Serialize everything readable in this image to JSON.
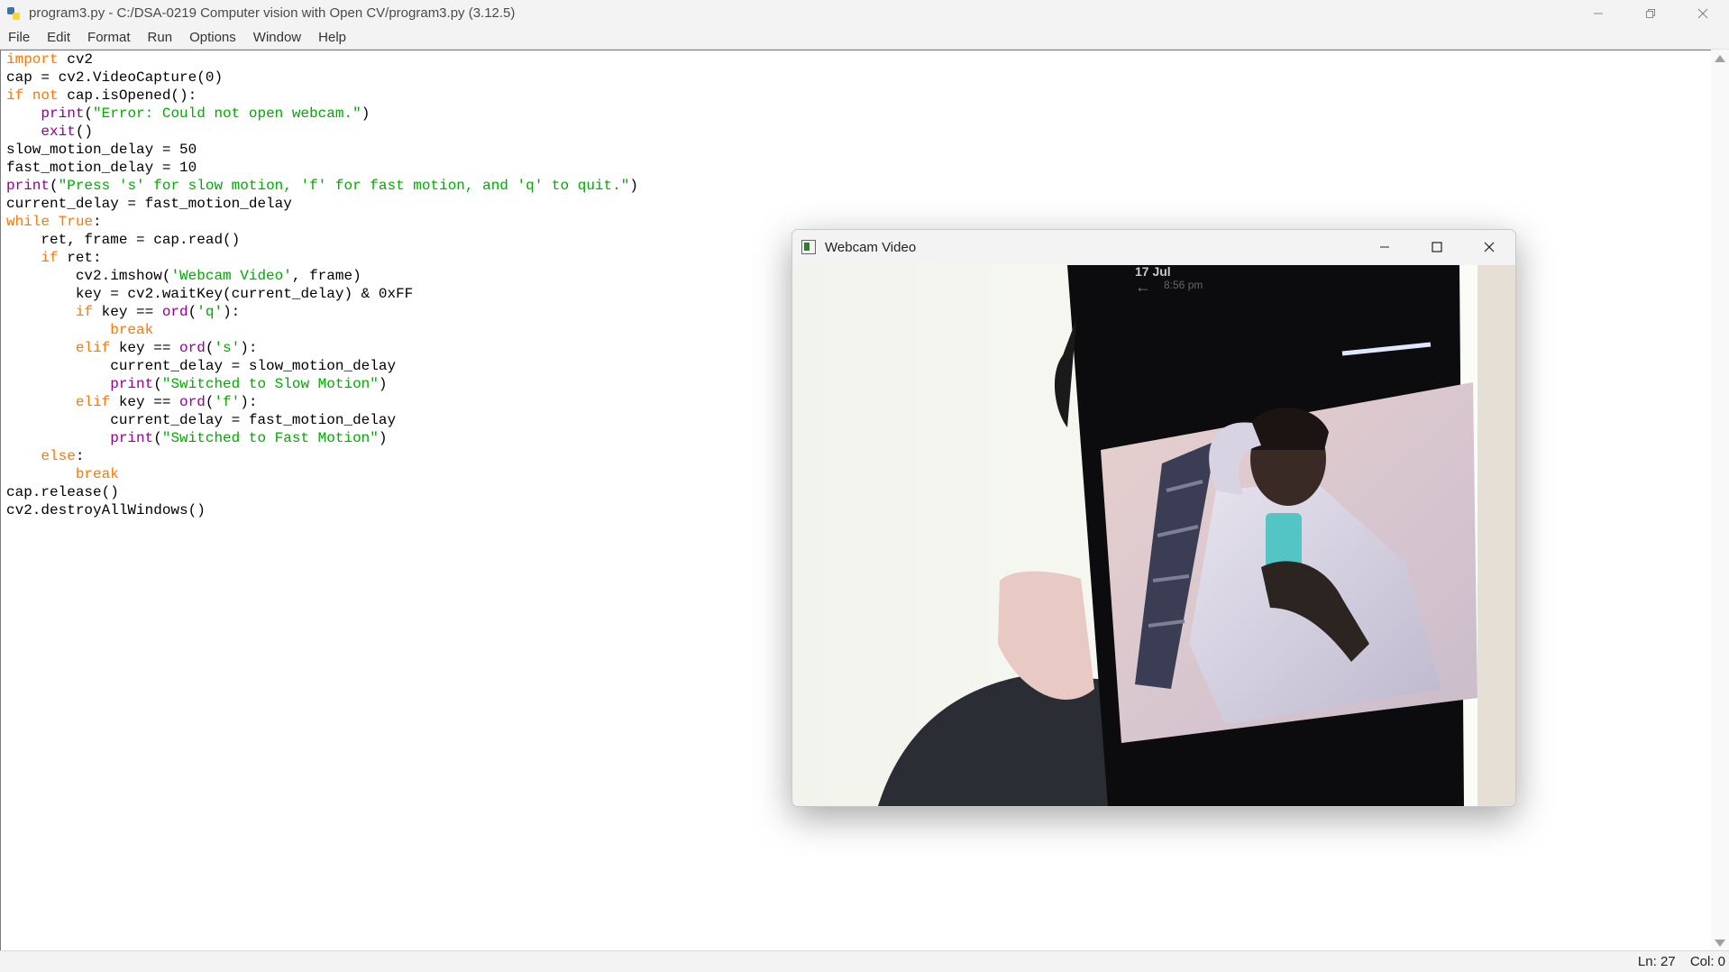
{
  "window": {
    "title": "program3.py - C:/DSA-0219 Computer vision with Open CV/program3.py (3.12.5)",
    "minimize_icon": "minimize-icon",
    "restore_icon": "restore-icon",
    "close_icon": "close-icon"
  },
  "menu": [
    "File",
    "Edit",
    "Format",
    "Run",
    "Options",
    "Window",
    "Help"
  ],
  "code_lines": [
    [
      [
        "kw",
        "import"
      ],
      [
        "t",
        " cv2"
      ]
    ],
    [
      [
        "t",
        "cap = cv2.VideoCapture(0)"
      ]
    ],
    [
      [
        "kw",
        "if not"
      ],
      [
        "t",
        " cap.isOpened():"
      ]
    ],
    [
      [
        "t",
        "    "
      ],
      [
        "bi",
        "print"
      ],
      [
        "t",
        "("
      ],
      [
        "str",
        "\"Error: Could not open webcam.\""
      ],
      [
        "t",
        ")"
      ]
    ],
    [
      [
        "t",
        "    "
      ],
      [
        "bi",
        "exit"
      ],
      [
        "t",
        "()"
      ]
    ],
    [
      [
        "t",
        "slow_motion_delay = 50"
      ]
    ],
    [
      [
        "t",
        "fast_motion_delay = 10"
      ]
    ],
    [
      [
        "bi",
        "print"
      ],
      [
        "t",
        "("
      ],
      [
        "str",
        "\"Press 's' for slow motion, 'f' for fast motion, and 'q' to quit.\""
      ],
      [
        "t",
        ")"
      ]
    ],
    [
      [
        "t",
        "current_delay = fast_motion_delay"
      ]
    ],
    [
      [
        "kw",
        "while"
      ],
      [
        "t",
        " "
      ],
      [
        "kw",
        "True"
      ],
      [
        "t",
        ":"
      ]
    ],
    [
      [
        "t",
        "    ret, frame = cap.read()"
      ]
    ],
    [
      [
        "t",
        "    "
      ],
      [
        "kw",
        "if"
      ],
      [
        "t",
        " ret:"
      ]
    ],
    [
      [
        "t",
        "        cv2.imshow("
      ],
      [
        "str",
        "'Webcam Video'"
      ],
      [
        "t",
        ", frame)"
      ]
    ],
    [
      [
        "t",
        "        key = cv2.waitKey(current_delay) & 0xFF"
      ]
    ],
    [
      [
        "t",
        "        "
      ],
      [
        "kw",
        "if"
      ],
      [
        "t",
        " key == "
      ],
      [
        "bi",
        "ord"
      ],
      [
        "t",
        "("
      ],
      [
        "str",
        "'q'"
      ],
      [
        "t",
        "):"
      ]
    ],
    [
      [
        "t",
        "            "
      ],
      [
        "kw",
        "break"
      ]
    ],
    [
      [
        "t",
        "        "
      ],
      [
        "kw",
        "elif"
      ],
      [
        "t",
        " key == "
      ],
      [
        "bi",
        "ord"
      ],
      [
        "t",
        "("
      ],
      [
        "str",
        "'s'"
      ],
      [
        "t",
        "):"
      ]
    ],
    [
      [
        "t",
        "            current_delay = slow_motion_delay"
      ]
    ],
    [
      [
        "t",
        "            "
      ],
      [
        "bi",
        "print"
      ],
      [
        "t",
        "("
      ],
      [
        "str",
        "\"Switched to Slow Motion\""
      ],
      [
        "t",
        ")"
      ]
    ],
    [
      [
        "t",
        "        "
      ],
      [
        "kw",
        "elif"
      ],
      [
        "t",
        " key == "
      ],
      [
        "bi",
        "ord"
      ],
      [
        "t",
        "("
      ],
      [
        "str",
        "'f'"
      ],
      [
        "t",
        "):"
      ]
    ],
    [
      [
        "t",
        "            current_delay = fast_motion_delay"
      ]
    ],
    [
      [
        "t",
        "            "
      ],
      [
        "bi",
        "print"
      ],
      [
        "t",
        "("
      ],
      [
        "str",
        "\"Switched to Fast Motion\""
      ],
      [
        "t",
        ")"
      ]
    ],
    [
      [
        "t",
        "    "
      ],
      [
        "kw",
        "else"
      ],
      [
        "t",
        ":"
      ]
    ],
    [
      [
        "t",
        "        "
      ],
      [
        "kw",
        "break"
      ]
    ],
    [
      [
        "t",
        "cap.release()"
      ]
    ],
    [
      [
        "t",
        "cv2.destroyAllWindows()"
      ]
    ]
  ],
  "status": {
    "line": "Ln: 27",
    "col": "Col: 0"
  },
  "webcam_window": {
    "title": "Webcam Video",
    "phone_date": "17 Jul",
    "phone_time": "8:56 pm"
  },
  "colors": {
    "keyword": "#ff7700",
    "builtin": "#900090",
    "string": "#00aa00"
  }
}
